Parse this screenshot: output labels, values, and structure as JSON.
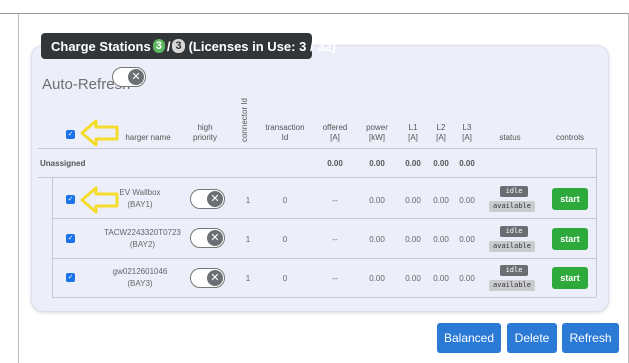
{
  "header": {
    "title": "Charge Stations",
    "count_green": "3",
    "separator": "/",
    "count_total": "3",
    "licenses": "(Licenses in Use: 3 / 32)"
  },
  "auto_refresh": {
    "label": "Auto-Refresh",
    "toggle_icon": "x-icon"
  },
  "table": {
    "columns": {
      "charger_name": "harger name",
      "high_priority": [
        "high",
        "priority"
      ],
      "connector_id": "connector Id",
      "transaction_id": [
        "transaction",
        "Id"
      ],
      "offered": [
        "offered",
        "[A]"
      ],
      "power": [
        "power",
        "[kW]"
      ],
      "l1": [
        "L1",
        "[A]"
      ],
      "l2": [
        "L2",
        "[A]"
      ],
      "l3": [
        "L3",
        "[A]"
      ],
      "status": "status",
      "controls": "controls"
    },
    "group": {
      "name": "Unassigned",
      "offered": "0.00",
      "power": "0.00",
      "l1": "0.00",
      "l2": "0.00",
      "l3": "0.00"
    },
    "rows": [
      {
        "name": "EV Wallbox",
        "sub": "(BAY1)",
        "connector": "1",
        "transaction": "0",
        "offered": "--",
        "power": "0.00",
        "l1": "0.00",
        "l2": "0.00",
        "l3": "0.00",
        "status1": "idle",
        "status2": "available",
        "button": "start"
      },
      {
        "name": "TACW2243320T0723",
        "sub": "(BAY2)",
        "connector": "1",
        "transaction": "0",
        "offered": "--",
        "power": "0.00",
        "l1": "0.00",
        "l2": "0.00",
        "l3": "0.00",
        "status1": "idle",
        "status2": "available",
        "button": "start"
      },
      {
        "name": "gw0212601046",
        "sub": "(BAY3)",
        "connector": "1",
        "transaction": "0",
        "offered": "--",
        "power": "0.00",
        "l1": "0.00",
        "l2": "0.00",
        "l3": "0.00",
        "status1": "idle",
        "status2": "available",
        "button": "start"
      }
    ]
  },
  "buttons": {
    "balanced": "Balanced",
    "delete": "Delete",
    "refresh": "Refresh"
  },
  "colors": {
    "accent_blue": "#2a7ad6",
    "start_green": "#2eaa3c",
    "arrow_yellow": "#f5dc2a",
    "tab_dark": "#333639"
  }
}
